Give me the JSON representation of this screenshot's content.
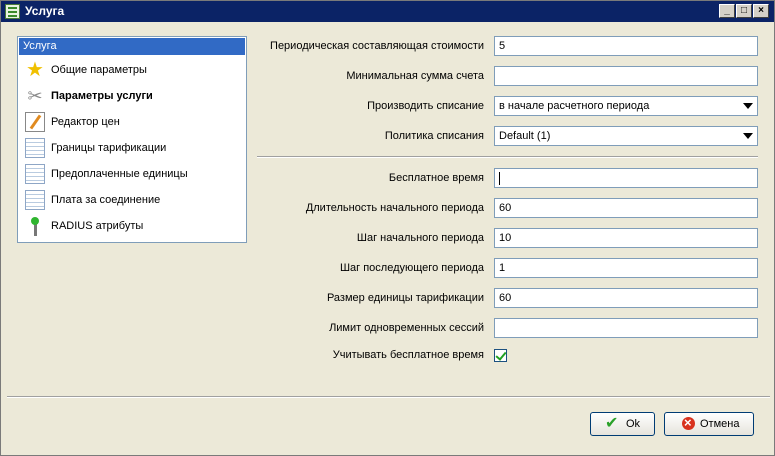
{
  "window": {
    "title": "Услуга",
    "min": "_",
    "max": "□",
    "close": "×"
  },
  "nav": {
    "header": "Услуга",
    "items": [
      {
        "label": "Общие параметры",
        "icon": "star-icon"
      },
      {
        "label": "Параметры услуги",
        "icon": "tools-icon"
      },
      {
        "label": "Редактор цен",
        "icon": "pencil-edit-icon"
      },
      {
        "label": "Границы тарификации",
        "icon": "sheet-icon"
      },
      {
        "label": "Предоплаченные единицы",
        "icon": "sheet-icon"
      },
      {
        "label": "Плата за соединение",
        "icon": "sheet-icon"
      },
      {
        "label": "RADIUS атрибуты",
        "icon": "antenna-icon"
      }
    ]
  },
  "form": {
    "periodic_cost": {
      "label": "Периодическая составляющая стоимости",
      "value": "5"
    },
    "min_invoice": {
      "label": "Минимальная сумма счета",
      "value": ""
    },
    "charge_timing": {
      "label": "Производить списание",
      "value": "в начале расчетного периода"
    },
    "charge_policy": {
      "label": "Политика списания",
      "value": "Default (1)"
    },
    "free_time": {
      "label": "Бесплатное время",
      "value": ""
    },
    "initial_duration": {
      "label": "Длительность начального периода",
      "value": "60"
    },
    "initial_step": {
      "label": "Шаг начального периода",
      "value": "10"
    },
    "next_step": {
      "label": "Шаг последующего периода",
      "value": "1"
    },
    "unit_size": {
      "label": "Размер единицы тарификации",
      "value": "60"
    },
    "session_limit": {
      "label": "Лимит одновременных сессий",
      "value": ""
    },
    "count_free_time": {
      "label": "Учитывать бесплатное время",
      "checked": true
    }
  },
  "buttons": {
    "ok": "Ok",
    "cancel": "Отмена"
  }
}
